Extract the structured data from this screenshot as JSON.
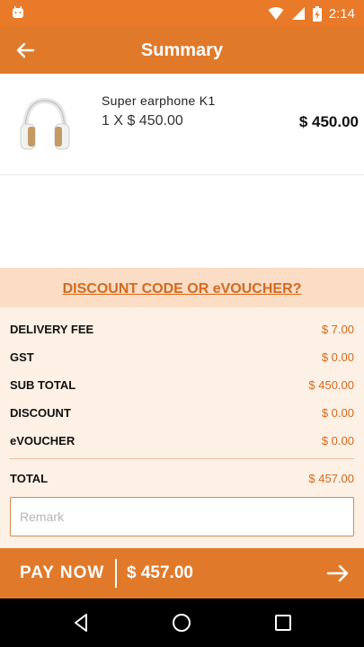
{
  "status_bar": {
    "time": "2:14",
    "icons": [
      "android-icon",
      "wifi-icon",
      "signal-icon",
      "battery-charging-icon"
    ]
  },
  "appbar": {
    "title": "Summary",
    "back_icon": "back-arrow-icon"
  },
  "product": {
    "name": "Super earphone K1",
    "quantity_line": "1 X $ 450.00",
    "total": "$ 450.00",
    "image_icon": "headphones-icon"
  },
  "discount": {
    "link_label": "DISCOUNT CODE OR eVOUCHER?"
  },
  "summary": {
    "rows": [
      {
        "label": "DELIVERY FEE",
        "value": "$ 7.00"
      },
      {
        "label": "GST",
        "value": "$ 0.00"
      },
      {
        "label": "SUB TOTAL",
        "value": "$ 450.00"
      },
      {
        "label": "DISCOUNT",
        "value": "$ 0.00"
      },
      {
        "label": "eVOUCHER",
        "value": "$ 0.00"
      }
    ],
    "total_label": "TOTAL",
    "total_value": "$ 457.00"
  },
  "remark": {
    "placeholder": "Remark",
    "value": ""
  },
  "pay_bar": {
    "label": "PAY NOW",
    "amount": "$ 457.00",
    "arrow_icon": "arrow-right-icon"
  },
  "navbar": {
    "icons": [
      "back-triangle-icon",
      "home-circle-icon",
      "recents-square-icon"
    ]
  },
  "colors": {
    "primary": "#e07a2a",
    "accent_text": "#d46a1e",
    "discount_bg": "#fbdcc4",
    "summary_bg": "#fdf0e4"
  }
}
